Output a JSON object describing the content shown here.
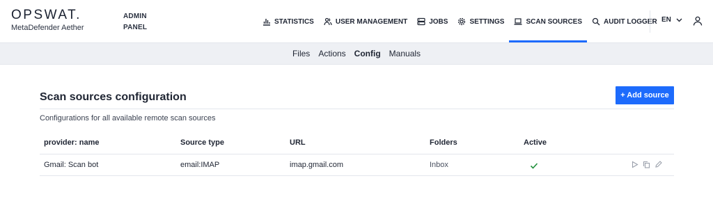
{
  "header": {
    "logo_main": "OPSWAT.",
    "logo_sub": "MetaDefender Aether",
    "panel_line1": "ADMIN",
    "panel_line2": "PANEL",
    "nav": [
      {
        "label": "STATISTICS",
        "icon": "bar-chart-icon"
      },
      {
        "label": "USER MANAGEMENT",
        "icon": "users-icon"
      },
      {
        "label": "JOBS",
        "icon": "server-icon"
      },
      {
        "label": "SETTINGS",
        "icon": "gear-icon"
      },
      {
        "label": "SCAN SOURCES",
        "icon": "laptop-icon",
        "active": true
      },
      {
        "label": "AUDIT LOGGER",
        "icon": "search-icon"
      }
    ],
    "language": "EN"
  },
  "subnav": {
    "tabs": [
      {
        "label": "Files"
      },
      {
        "label": "Actions"
      },
      {
        "label": "Config",
        "active": true
      },
      {
        "label": "Manuals"
      }
    ]
  },
  "main": {
    "title": "Scan sources configuration",
    "add_button": "+ Add source",
    "description": "Configurations for all available remote scan sources",
    "columns": [
      "provider: name",
      "Source type",
      "URL",
      "Folders",
      "Active"
    ],
    "rows": [
      {
        "provider": "Gmail:",
        "name": "Scan bot",
        "source_type": "email:IMAP",
        "url": "imap.gmail.com",
        "folders": "Inbox",
        "active": true
      }
    ]
  },
  "colors": {
    "accent": "#1d6bfc",
    "active_check": "#1f8f3a",
    "subnav_bg": "#eef0f4"
  }
}
